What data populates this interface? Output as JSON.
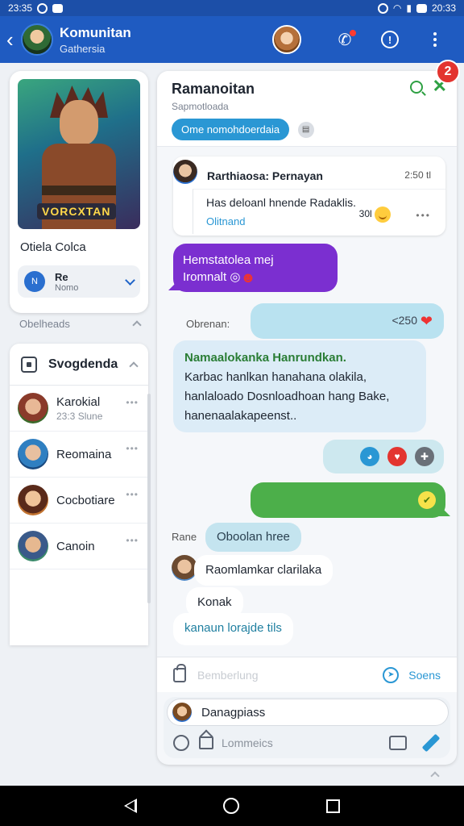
{
  "status_bar": {
    "time_left": "23:35",
    "time_right": "20:33"
  },
  "app_bar": {
    "title": "Komunitan",
    "subtitle": "Gathersia"
  },
  "game_card": {
    "game_logo": "VORCXTAN",
    "game_name": "Otiela Colca",
    "selector": {
      "icon_text": "N",
      "title": "Re",
      "subtitle": "Nomo"
    }
  },
  "section_label": "Obelheads",
  "channels": {
    "title": "Svogdenda",
    "items": [
      {
        "name": "Karokial",
        "sub": "23:3 Slune",
        "avatar_color": "#8a3a2a"
      },
      {
        "name": "Reomaina",
        "sub": "",
        "avatar_color": "#2f7fc1"
      },
      {
        "name": "Cocbotiare",
        "sub": "",
        "avatar_color": "#c1722f"
      },
      {
        "name": "Canoin",
        "sub": "",
        "avatar_color": "#3a8a6a"
      }
    ]
  },
  "chat": {
    "title": "Ramanoitan",
    "subtitle": "Sapmotloada",
    "pill_label": "Ome nomohdoerdaia",
    "notification_badge": "2",
    "card_message": {
      "title": "Rarthiaosa: Pernayan",
      "time": "2:50 tl",
      "body": "Has deloanl hnende Radaklis.",
      "footer": "Olitnand",
      "count": "30l"
    },
    "purple_bubble": {
      "line1": "Hemstatolea mej",
      "line2": "Iromnalt"
    },
    "reply_label": "Obrenan:",
    "blue_bubble_text": "<250",
    "long_bubble": {
      "headline": "Namaalokanka Hanrundkan.",
      "line1": "Karbac hanlkan hanahana olakila,",
      "line2": "hanlaloado Dosnloadhoan hang Bake,",
      "line3": "hanenaalakapeenst.."
    },
    "rn_label": "Rane",
    "tag_bubble": "Oboolan hree",
    "plain_1": "Raomlamkar clarilaka",
    "plain_2": "Konak",
    "plain_3": "kanaun lorajde tils",
    "bottom_bar": {
      "placeholder": "Bemberlung",
      "send_label": "Soens"
    },
    "composer": {
      "input_value": "Danagpiass",
      "placeholder": "Lommeics"
    }
  },
  "colors": {
    "accent": "#1f5bc1",
    "purple_bubble": "#7b2fd0",
    "green_bubble": "#4caf4a",
    "blue_bubble": "#b9e2f0",
    "badge": "#e3342f"
  }
}
